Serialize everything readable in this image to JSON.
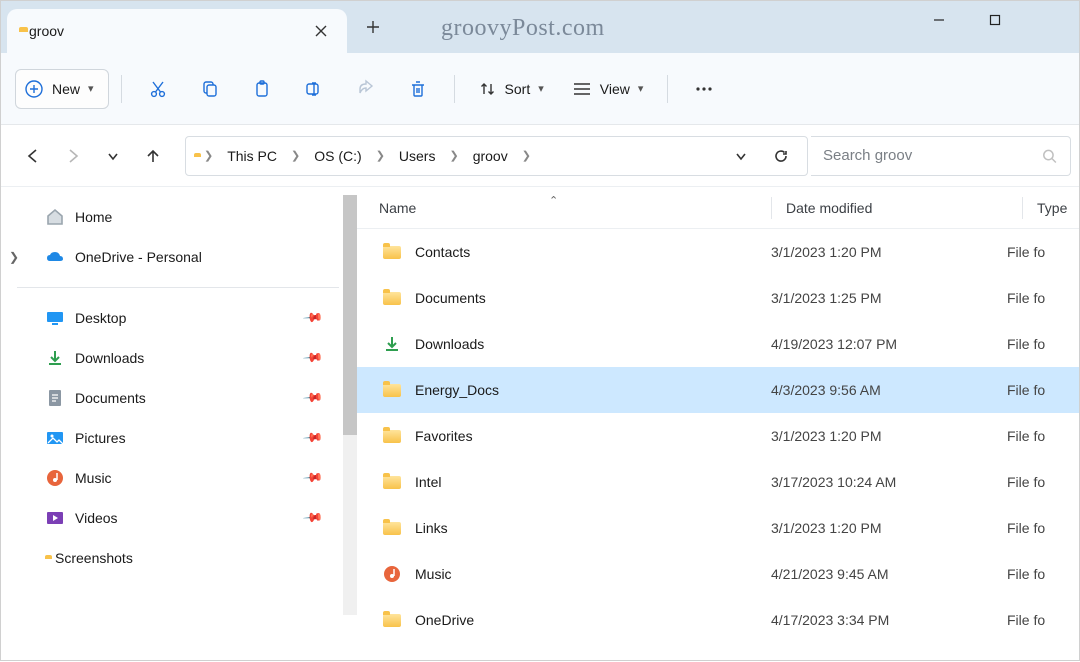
{
  "tab": {
    "title": "groov"
  },
  "watermark": "groovyPost.com",
  "toolbar": {
    "new_label": "New",
    "sort_label": "Sort",
    "view_label": "View"
  },
  "breadcrumb": [
    "This PC",
    "OS (C:)",
    "Users",
    "groov"
  ],
  "search_placeholder": "Search groov",
  "sidebar": {
    "home": "Home",
    "onedrive": "OneDrive - Personal",
    "quick": [
      {
        "label": "Desktop",
        "icon": "desktop",
        "pinned": true
      },
      {
        "label": "Downloads",
        "icon": "download",
        "pinned": true
      },
      {
        "label": "Documents",
        "icon": "document",
        "pinned": true
      },
      {
        "label": "Pictures",
        "icon": "pictures",
        "pinned": true
      },
      {
        "label": "Music",
        "icon": "music",
        "pinned": true
      },
      {
        "label": "Videos",
        "icon": "videos",
        "pinned": true
      },
      {
        "label": "Screenshots",
        "icon": "folder",
        "pinned": false
      }
    ]
  },
  "columns": {
    "name": "Name",
    "date": "Date modified",
    "type": "Type"
  },
  "files": [
    {
      "name": "Contacts",
      "date": "3/1/2023 1:20 PM",
      "type": "File fo",
      "icon": "folder",
      "selected": false
    },
    {
      "name": "Documents",
      "date": "3/1/2023 1:25 PM",
      "type": "File fo",
      "icon": "folder",
      "selected": false
    },
    {
      "name": "Downloads",
      "date": "4/19/2023 12:07 PM",
      "type": "File fo",
      "icon": "download",
      "selected": false
    },
    {
      "name": "Energy_Docs",
      "date": "4/3/2023 9:56 AM",
      "type": "File fo",
      "icon": "folder",
      "selected": true
    },
    {
      "name": "Favorites",
      "date": "3/1/2023 1:20 PM",
      "type": "File fo",
      "icon": "folder",
      "selected": false
    },
    {
      "name": "Intel",
      "date": "3/17/2023 10:24 AM",
      "type": "File fo",
      "icon": "folder",
      "selected": false
    },
    {
      "name": "Links",
      "date": "3/1/2023 1:20 PM",
      "type": "File fo",
      "icon": "folder",
      "selected": false
    },
    {
      "name": "Music",
      "date": "4/21/2023 9:45 AM",
      "type": "File fo",
      "icon": "music",
      "selected": false
    },
    {
      "name": "OneDrive",
      "date": "4/17/2023 3:34 PM",
      "type": "File fo",
      "icon": "folder",
      "selected": false
    }
  ]
}
